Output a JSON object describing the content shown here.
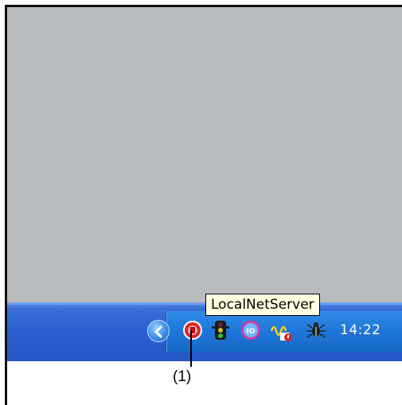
{
  "tooltip": {
    "text": "LocalNetServer"
  },
  "tray": {
    "clock": "14:22",
    "icons": [
      {
        "name": "show-hidden-icons-chevron-icon"
      },
      {
        "name": "localnetserver-icon"
      },
      {
        "name": "traffic-light-icon"
      },
      {
        "name": "io-icon"
      },
      {
        "name": "signal-warning-icon"
      },
      {
        "name": "bug-icon"
      }
    ]
  },
  "callout": {
    "label": "(1)"
  },
  "colors": {
    "desktop": "#babdbf",
    "taskbar": "#2c5fcf",
    "tray": "#1f76d8",
    "tooltip_bg": "#ffffe1"
  }
}
